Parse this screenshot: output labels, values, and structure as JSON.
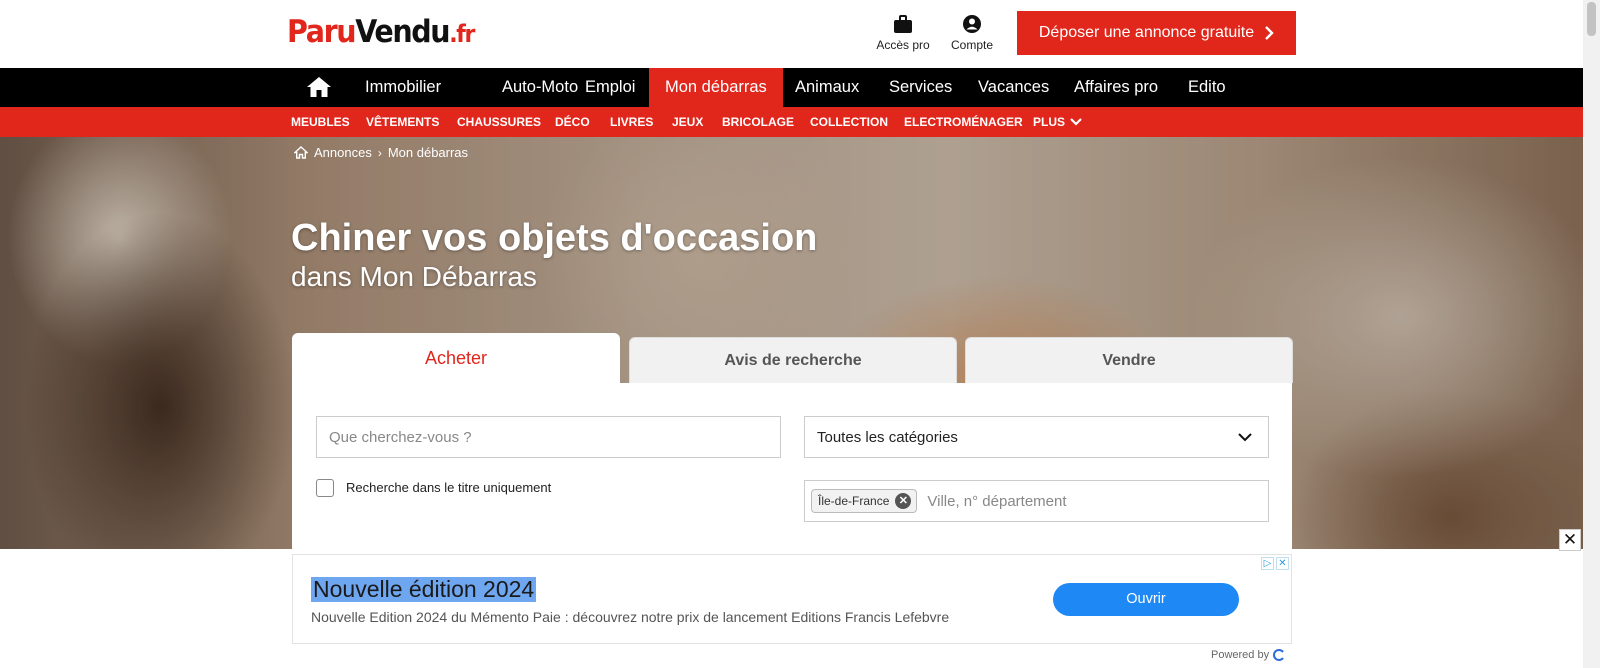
{
  "header": {
    "logo": {
      "part1": "Paru",
      "part2": "Vendu",
      "part3": ".fr"
    },
    "acces_pro": "Accès pro",
    "compte": "Compte",
    "deposit_button": "Déposer une annonce gratuite"
  },
  "main_nav": [
    "Immobilier",
    "Auto-Moto",
    "Emploi",
    "Mon débarras",
    "Animaux",
    "Services",
    "Vacances",
    "Affaires pro",
    "Edito"
  ],
  "sub_nav": [
    "MEUBLES",
    "VÊTEMENTS",
    "CHAUSSURES",
    "DÉCO",
    "LIVRES",
    "JEUX",
    "BRICOLAGE",
    "COLLECTION",
    "ELECTROMÉNAGER",
    "PLUS"
  ],
  "breadcrumb": {
    "items": [
      "Annonces",
      "Mon débarras"
    ]
  },
  "hero": {
    "title": "Chiner vos objets d'occasion",
    "subtitle": "dans Mon Débarras"
  },
  "search": {
    "tabs": [
      "Acheter",
      "Avis de recherche",
      "Vendre"
    ],
    "query_placeholder": "Que cherchez-vous ?",
    "category_value": "Toutes les catégories",
    "title_only_label": "Recherche dans le titre uniquement",
    "location_chip": "Île-de-France",
    "location_placeholder": "Ville, n° département"
  },
  "ad": {
    "title": "Nouvelle édition 2024",
    "description": "Nouvelle Edition 2024 du Mémento Paie : découvrez notre prix de lancement Editions Francis Lefebvre",
    "button": "Ouvrir",
    "powered_by": "Powered by"
  },
  "colors": {
    "brand_red": "#e1261c",
    "nav_black": "#000000",
    "ad_button_blue": "#1e88f5"
  }
}
